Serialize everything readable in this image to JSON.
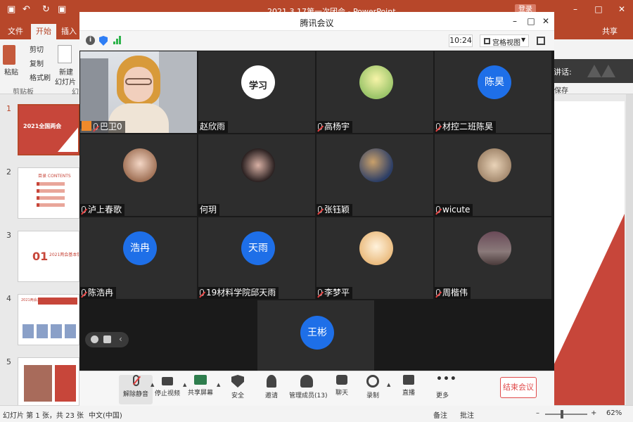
{
  "ppt": {
    "title": "2021.3.17第一次团会 - PowerPoint",
    "login": "登录",
    "tabs": [
      "文件",
      "开始",
      "插入"
    ],
    "share": "共享",
    "ribbon": {
      "paste": "粘贴",
      "cut": "剪切",
      "copy": "复制",
      "format_painter": "格式刷",
      "new_slide": "新建",
      "new_slide2": "幻灯片",
      "clipboard_group": "剪贴板",
      "slides_group": "幻",
      "save_label": "保存"
    },
    "slides": [
      {
        "num": "1",
        "text": "2021全国两会"
      },
      {
        "num": "2",
        "text": "目录 CONTENTS"
      },
      {
        "num": "3",
        "text": "2021两会基本情况",
        "big": "01"
      },
      {
        "num": "4",
        "text": "2021两会基本情况"
      },
      {
        "num": "5",
        "text": ""
      }
    ],
    "status": {
      "slide_info": "幻灯片 第 1 张，共 23 张",
      "lang": "中文(中国)",
      "notes": "备注",
      "comments": "批注",
      "zoom": "62%"
    },
    "speaking": "正在讲话:"
  },
  "meeting": {
    "title": "腾讯会议",
    "time": "10:24",
    "view": "宫格视图",
    "participants": [
      {
        "name": "巴卫0",
        "type": "video",
        "host": true
      },
      {
        "name": "赵欣雨",
        "type": "image",
        "avatar_text": "学习"
      },
      {
        "name": "高杨宇",
        "type": "image"
      },
      {
        "name": "材控二班陈昊",
        "type": "text",
        "avatar_text": "陈昊"
      },
      {
        "name": "泸上春歌",
        "type": "image"
      },
      {
        "name": "何玥",
        "type": "image"
      },
      {
        "name": "张钰颖",
        "type": "image"
      },
      {
        "name": "wicute",
        "type": "image"
      },
      {
        "name": "陈浩冉",
        "type": "text",
        "avatar_text": "浩冉"
      },
      {
        "name": "19材料学院邱天雨",
        "type": "text",
        "avatar_text": "天雨"
      },
      {
        "name": "李梦平",
        "type": "image"
      },
      {
        "name": "周楷伟",
        "type": "image"
      },
      {
        "name": "",
        "type": "text",
        "avatar_text": "王彬"
      }
    ],
    "controls": [
      {
        "label": "解除静音",
        "icon": "mic-muted-icon"
      },
      {
        "label": "停止视频",
        "icon": "camera-icon"
      },
      {
        "label": "共享屏幕",
        "icon": "share-screen-icon"
      },
      {
        "label": "安全",
        "icon": "security-icon"
      },
      {
        "label": "邀请",
        "icon": "invite-icon"
      },
      {
        "label": "管理成员(13)",
        "icon": "members-icon"
      },
      {
        "label": "聊天",
        "icon": "chat-icon"
      },
      {
        "label": "录制",
        "icon": "record-icon"
      },
      {
        "label": "直播",
        "icon": "live-icon"
      },
      {
        "label": "更多",
        "icon": "more-icon"
      }
    ],
    "end_label": "结束会议"
  },
  "colors": {
    "ppt_accent": "#b7472a",
    "avatar_blue": "#1e6fe8",
    "end_red": "#e04a4a"
  }
}
